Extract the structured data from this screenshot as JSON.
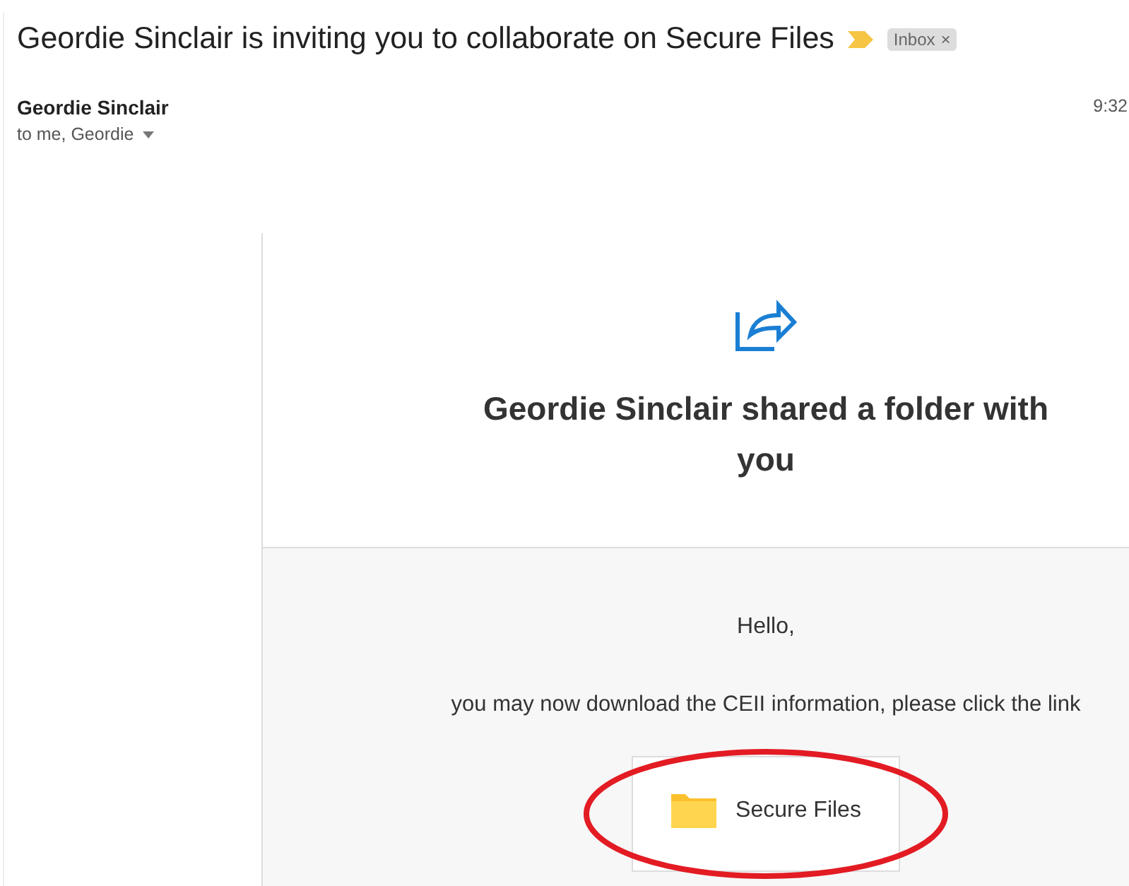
{
  "subject": "Geordie Sinclair is inviting you to collaborate on Secure Files",
  "important": true,
  "label": {
    "text": "Inbox",
    "remove": "×"
  },
  "sender": {
    "name": "Geordie Sinclair",
    "recipients": "to me, Geordie",
    "time": "9:32"
  },
  "card": {
    "heading": "Geordie Sinclair shared a folder with you",
    "greeting": "Hello,",
    "message": "you may now download the CEII information, please click the link",
    "link": {
      "label": "Secure Files",
      "circled": true
    }
  }
}
